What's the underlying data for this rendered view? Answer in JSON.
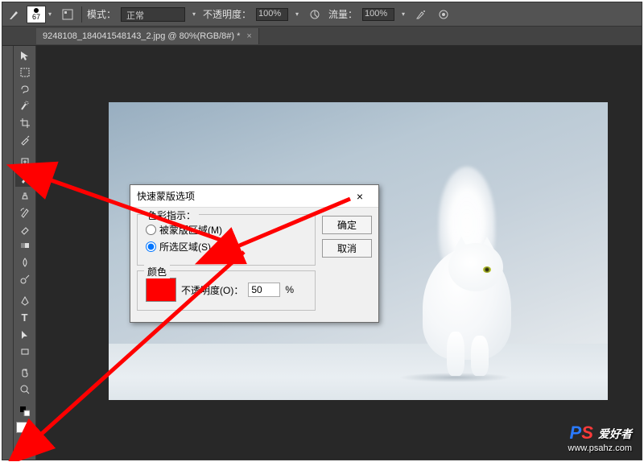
{
  "options_bar": {
    "brush_size": "67",
    "mode_label": "模式：",
    "mode_value": "正常",
    "opacity_label": "不透明度：",
    "opacity_value": "100%",
    "flow_label": "流量：",
    "flow_value": "100%"
  },
  "document_tab": {
    "title": "9248108_184041548143_2.jpg @ 80%(RGB/8#) *",
    "close": "×"
  },
  "dialog": {
    "title": "快速蒙版选项",
    "close": "×",
    "color_indicates_legend": "色彩指示：",
    "radio_masked": "被蒙版区域(M)",
    "radio_selected": "所选区域(S)",
    "selected_option": "selected",
    "color_legend": "颜色",
    "opacity_label": "不透明度(O)：",
    "opacity_value": "50",
    "opacity_unit": "%",
    "color_swatch": "#ff0000",
    "ok": "确定",
    "cancel": "取消"
  },
  "watermark": {
    "brand_cn": "爱好者",
    "url": "www.psahz.com"
  },
  "tools": {
    "move": "move-tool",
    "marquee": "rectangular-marquee-tool",
    "lasso": "lasso-tool",
    "quick_select": "quick-selection-tool",
    "crop": "crop-tool",
    "eyedropper": "eyedropper-tool",
    "healing": "spot-healing-brush-tool",
    "brush": "brush-tool",
    "stamp": "clone-stamp-tool",
    "history": "history-brush-tool",
    "eraser": "eraser-tool",
    "gradient": "gradient-tool",
    "blur": "blur-tool",
    "dodge": "dodge-tool",
    "pen": "pen-tool",
    "type": "type-tool",
    "path": "path-selection-tool",
    "shape": "rectangle-tool",
    "hand": "hand-tool",
    "zoom": "zoom-tool",
    "quickmask": "quick-mask-mode"
  }
}
